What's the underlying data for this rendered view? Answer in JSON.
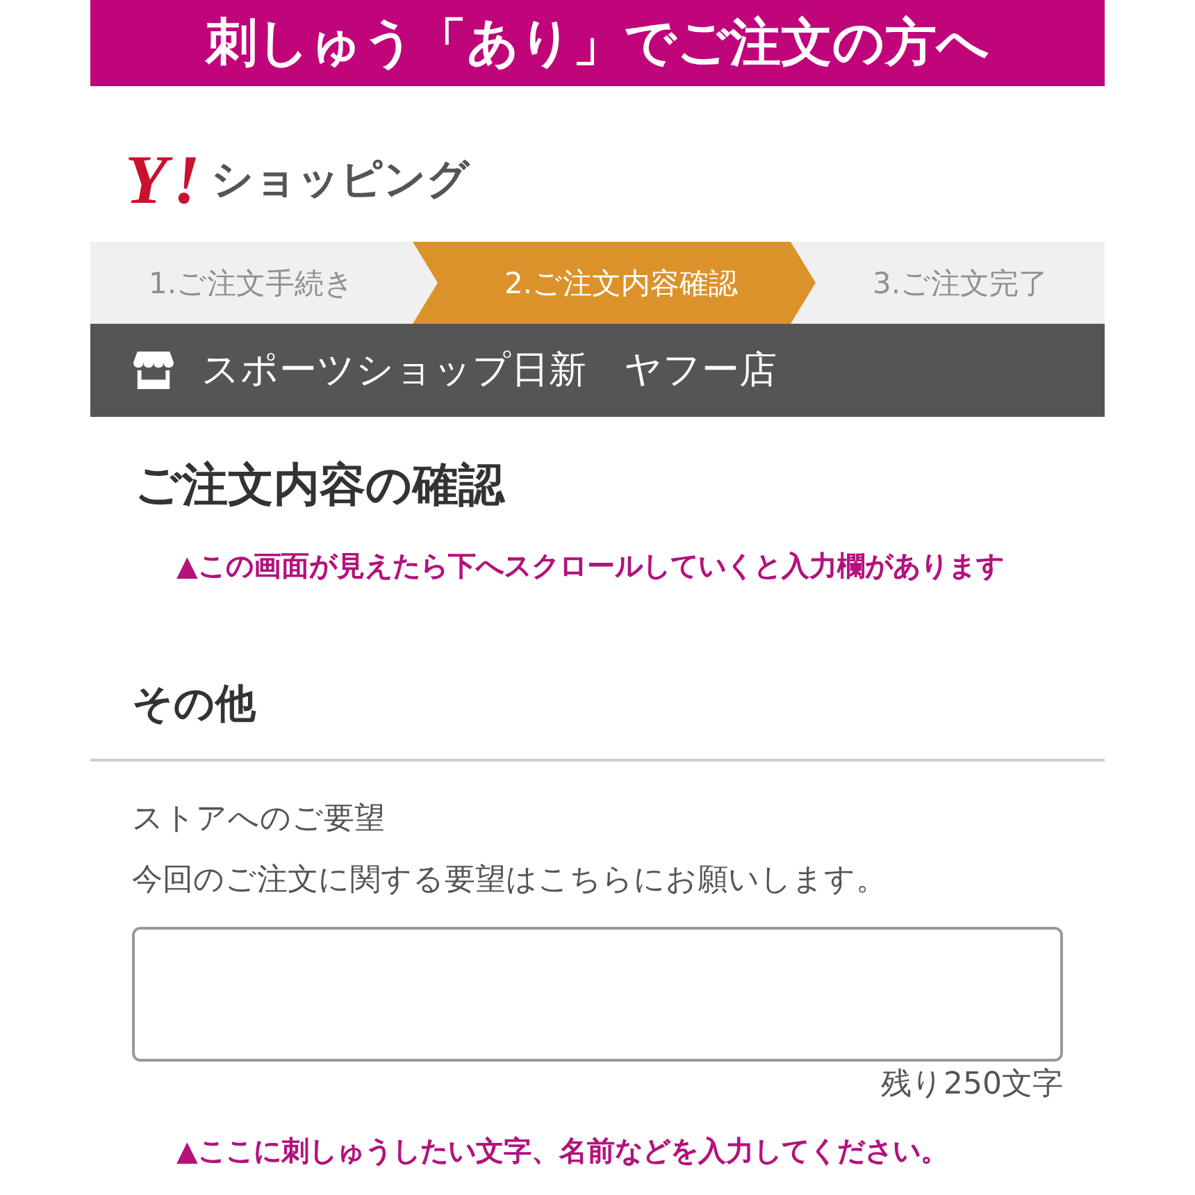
{
  "banner": {
    "text": "刺しゅう「あり」でご注文の方へ"
  },
  "header": {
    "logo_mark": "Y!",
    "logo_text": "ショッピング"
  },
  "steps": [
    {
      "label": "1.ご注文手続き",
      "selected": false
    },
    {
      "label": "2.ご注文内容確認",
      "selected": true
    },
    {
      "label": "3.ご注文完了",
      "selected": false
    }
  ],
  "store": {
    "name": "スポーツショップ日新　ヤフー店"
  },
  "confirmation": {
    "title": "ご注文内容の確認",
    "note": "▲この画面が見えたら下へスクロールしていくと入力欄があります"
  },
  "other_section": {
    "title": "その他",
    "field_label": "ストアへのご要望",
    "description": "今回のご注文に関する要望はこちらにお願いします。",
    "counter": "残り250文字",
    "note": "▲ここに刺しゅうしたい文字、名前などを入力してください。"
  }
}
